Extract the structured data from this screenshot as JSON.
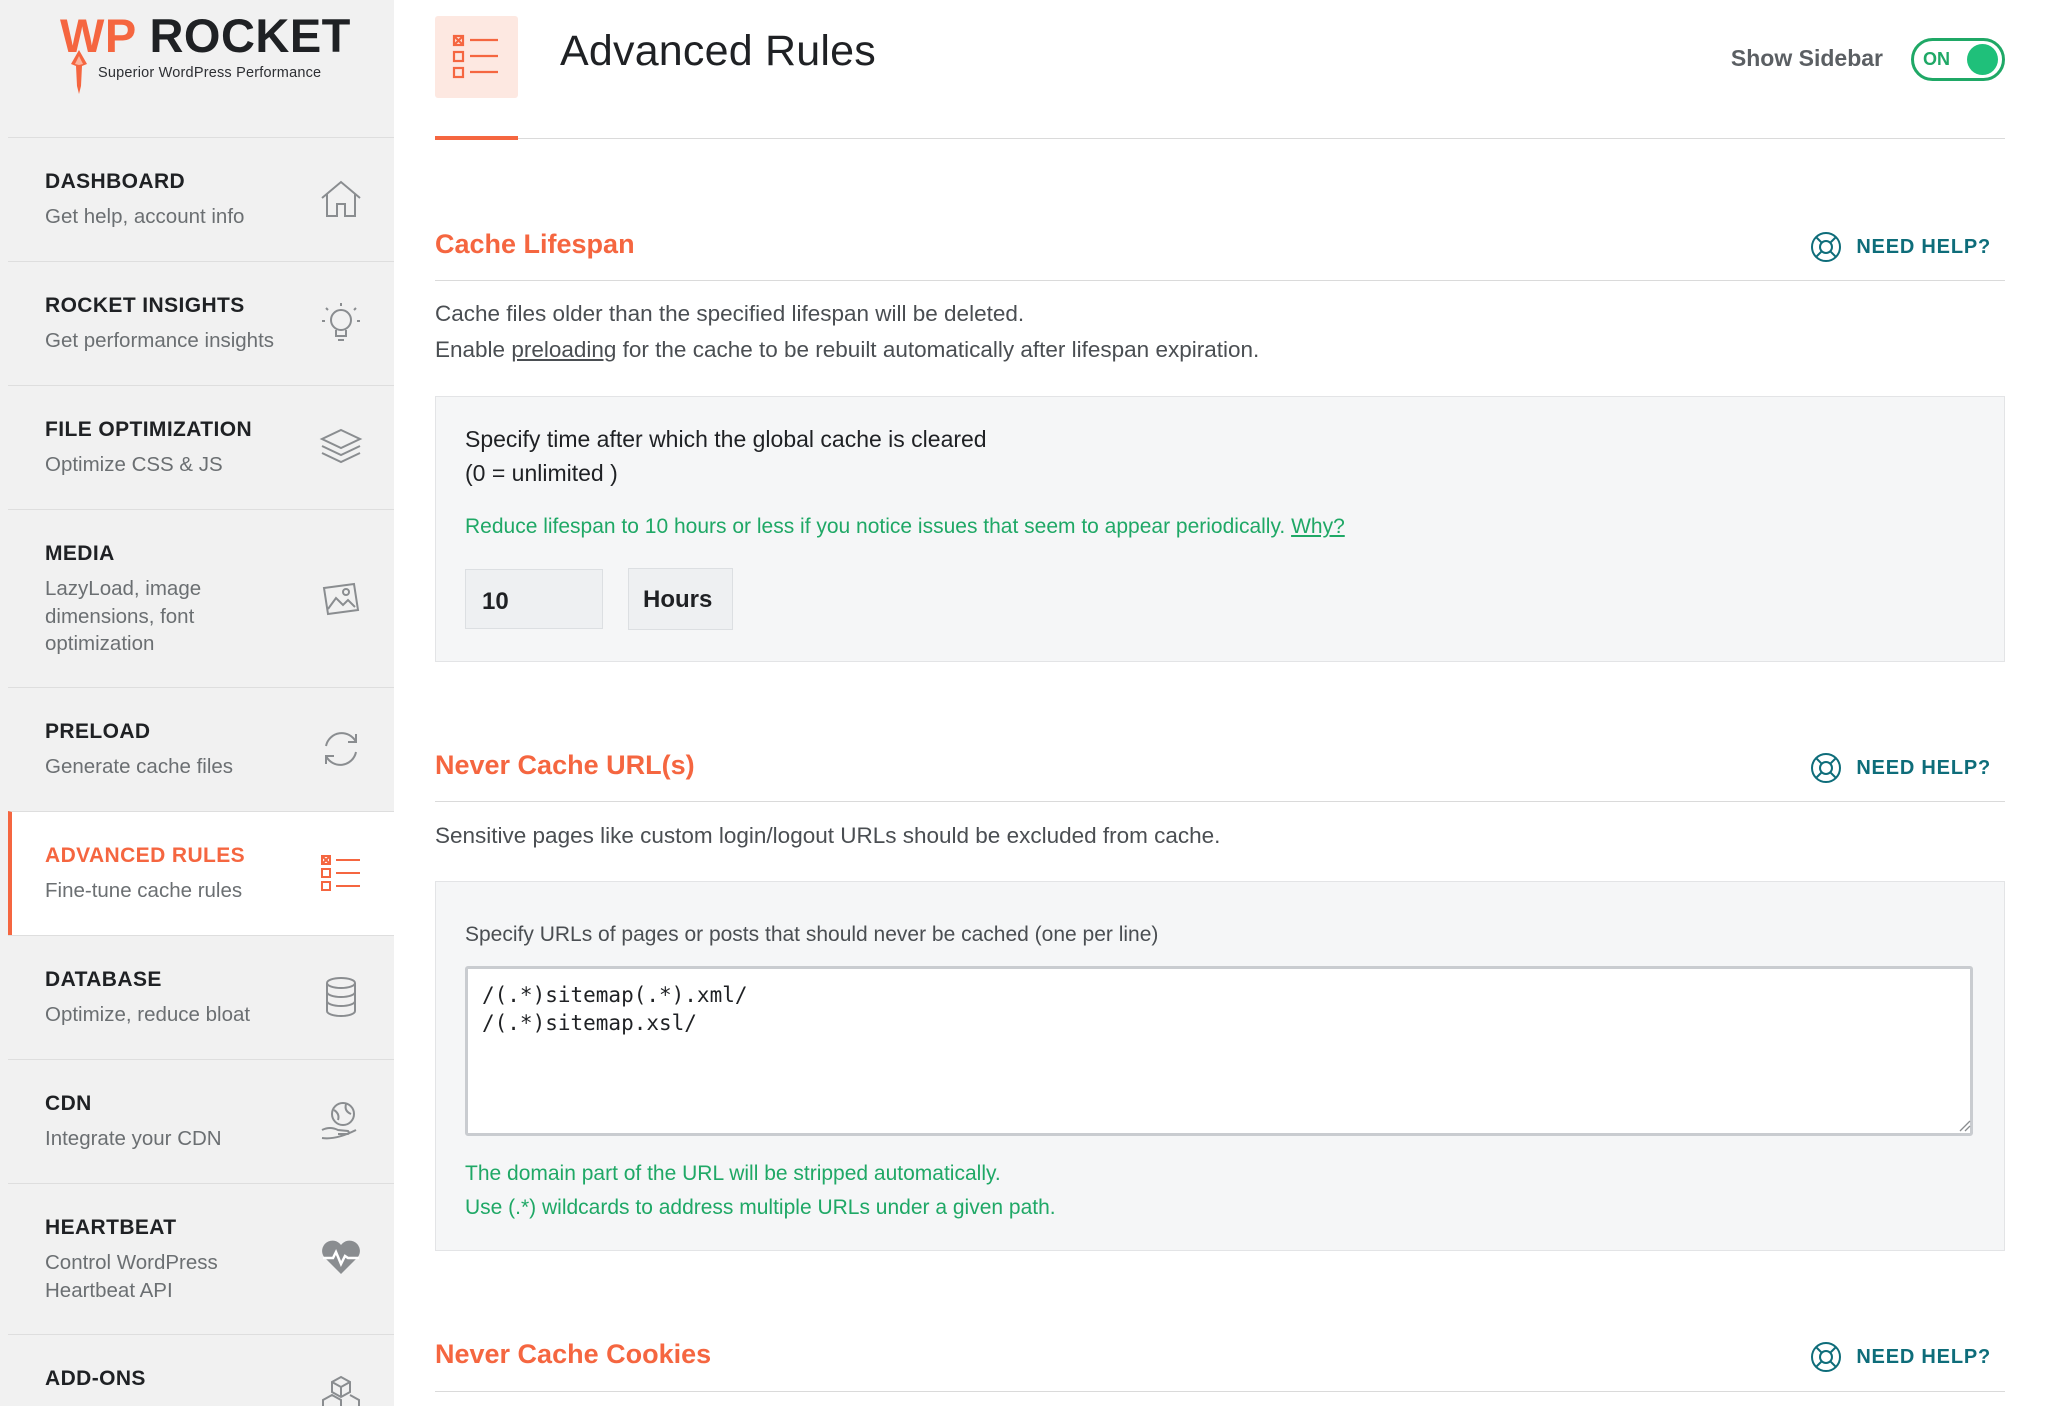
{
  "logo": {
    "wp": "WP",
    "rocket": "ROCKET",
    "tagline": "Superior WordPress Performance"
  },
  "sidebar": {
    "items": [
      {
        "title": "DASHBOARD",
        "subtitle": "Get help, account info",
        "icon": "house-icon"
      },
      {
        "title": "ROCKET INSIGHTS",
        "subtitle": "Get performance insights",
        "icon": "lightbulb-icon"
      },
      {
        "title": "FILE OPTIMIZATION",
        "subtitle": "Optimize CSS & JS",
        "icon": "layers-icon"
      },
      {
        "title": "MEDIA",
        "subtitle": "LazyLoad, image dimensions, font optimization",
        "icon": "images-icon"
      },
      {
        "title": "PRELOAD",
        "subtitle": "Generate cache files",
        "icon": "refresh-icon"
      },
      {
        "title": "ADVANCED RULES",
        "subtitle": "Fine-tune cache rules",
        "icon": "checklist-icon",
        "active": true
      },
      {
        "title": "DATABASE",
        "subtitle": "Optimize, reduce bloat",
        "icon": "database-icon"
      },
      {
        "title": "CDN",
        "subtitle": "Integrate your CDN",
        "icon": "globe-hand-icon"
      },
      {
        "title": "HEARTBEAT",
        "subtitle": "Control WordPress Heartbeat API",
        "icon": "heartbeat-icon"
      },
      {
        "title": "ADD-ONS",
        "subtitle": "",
        "icon": "cubes-icon"
      }
    ]
  },
  "header": {
    "title": "Advanced Rules",
    "show_sidebar_label": "Show Sidebar",
    "toggle_state": "ON"
  },
  "sections": {
    "cache_lifespan": {
      "title": "Cache Lifespan",
      "help": "NEED HELP?",
      "desc_line1": "Cache files older than the specified lifespan will be deleted.",
      "desc_line2_before": "Enable ",
      "desc_line2_link": "preloading",
      "desc_line2_after": " for the cache to be rebuilt automatically after lifespan expiration.",
      "field_label_line1": "Specify time after which the global cache is cleared",
      "field_label_line2": "(0 = unlimited )",
      "hint_text": "Reduce lifespan to 10 hours or less if you notice issues that seem to appear periodically. ",
      "hint_link": "Why?",
      "value": "10",
      "unit": "Hours"
    },
    "never_cache_urls": {
      "title": "Never Cache URL(s)",
      "help": "NEED HELP?",
      "desc": "Sensitive pages like custom login/logout URLs should be excluded from cache.",
      "field_label": "Specify URLs of pages or posts that should never be cached (one per line)",
      "textarea_value": "/(.*)sitemap(.*).xml/\n/(.*)sitemap.xsl/",
      "hint_line1": "The domain part of the URL will be stripped automatically.",
      "hint_line2": "Use (.*) wildcards to address multiple URLs under a given path."
    },
    "never_cache_cookies": {
      "title": "Never Cache Cookies",
      "help": "NEED HELP?"
    }
  },
  "colors": {
    "accent": "#f56640",
    "success": "#1fa866",
    "help": "#0e6d7a"
  }
}
